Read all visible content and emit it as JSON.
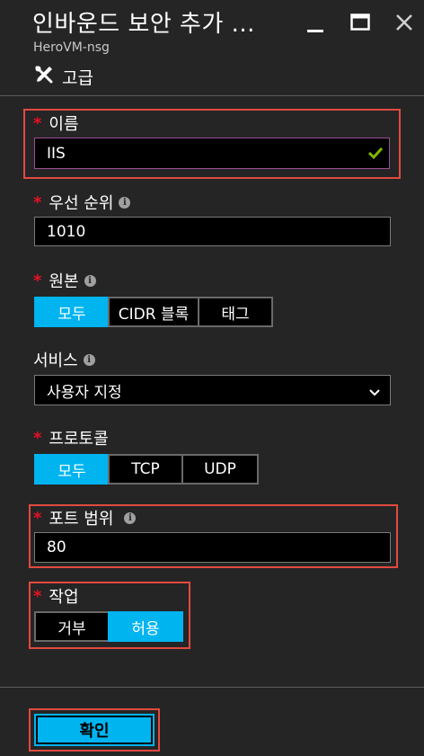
{
  "header": {
    "title": "인바운드 보안 추가 ...",
    "subtitle": "HeroVM-nsg",
    "advanced_label": "고급"
  },
  "name_field": {
    "label": "이름",
    "value": "IIS",
    "required": true,
    "valid": true
  },
  "priority_field": {
    "label": "우선 순위",
    "value": "1010",
    "required": true
  },
  "source_field": {
    "label": "원본",
    "required": true,
    "options": [
      "모두",
      "CIDR 블록",
      "태그"
    ],
    "selected": "모두"
  },
  "service_field": {
    "label": "서비스",
    "value": "사용자 지정"
  },
  "protocol_field": {
    "label": "프로토콜",
    "required": true,
    "options": [
      "모두",
      "TCP",
      "UDP"
    ],
    "selected": "모두"
  },
  "port_range_field": {
    "label": "포트 범위",
    "value": "80",
    "required": true
  },
  "action_field": {
    "label": "작업",
    "required": true,
    "options": [
      "거부",
      "허용"
    ],
    "selected": "허용"
  },
  "footer": {
    "ok_label": "확인"
  },
  "colors": {
    "accent": "#00b4f0",
    "highlight_box": "#e24a3f",
    "required_star": "#e81123",
    "valid_check": "#7fba00",
    "background": "#252526"
  }
}
